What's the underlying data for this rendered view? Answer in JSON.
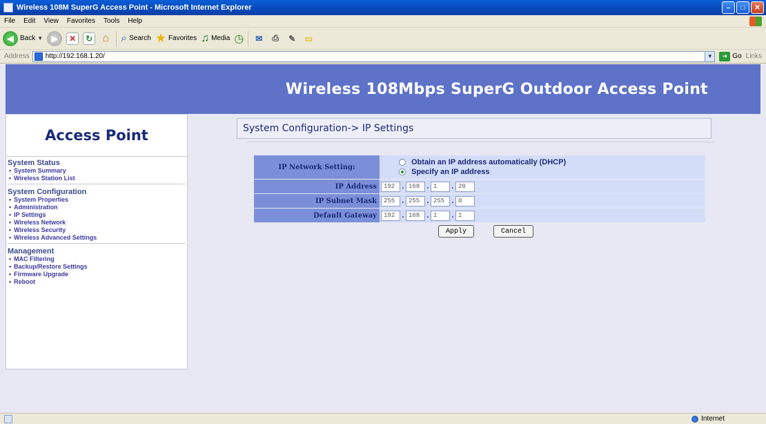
{
  "window": {
    "title": "Wireless 108M SuperG Access Point - Microsoft Internet Explorer"
  },
  "menu": [
    "File",
    "Edit",
    "View",
    "Favorites",
    "Tools",
    "Help"
  ],
  "toolbar": {
    "back_label": "Back",
    "search_label": "Search",
    "favorites_label": "Favorites",
    "media_label": "Media"
  },
  "address": {
    "label": "Address",
    "url": "http://192.168.1.20/",
    "go_label": "Go",
    "links_label": "Links"
  },
  "banner": {
    "title": "Wireless 108Mbps SuperG Outdoor Access Point"
  },
  "sidebar": {
    "title": "Access Point",
    "sections": [
      {
        "heading": "System Status",
        "items": [
          "System Summary",
          "Wireless Station List"
        ]
      },
      {
        "heading": "System Configuration",
        "items": [
          "System Properties",
          "Administration",
          "IP Settings",
          "Wireless Network",
          "Wireless Security",
          "Wireless Advanced Settings"
        ]
      },
      {
        "heading": "Management",
        "items": [
          "MAC Filtering",
          "Backup/Restore Settings",
          "Firmware Upgrade",
          "Reboot"
        ]
      }
    ]
  },
  "main": {
    "breadcrumb": "System Configuration-> IP Settings",
    "form": {
      "network_setting_label": "IP Network Setting:",
      "dhcp_option": "Obtain an IP address automatically (DHCP)",
      "static_option": "Specify an IP address",
      "selected_option": "static",
      "ip_label": "IP Address",
      "ip": [
        "192",
        "168",
        "1",
        "20"
      ],
      "subnet_label": "IP Subnet Mask",
      "subnet": [
        "255",
        "255",
        "255",
        "0"
      ],
      "gateway_label": "Default Gateway",
      "gateway": [
        "192",
        "168",
        "1",
        "1"
      ],
      "apply_label": "Apply",
      "cancel_label": "Cancel"
    }
  },
  "status": {
    "zone": "Internet"
  }
}
